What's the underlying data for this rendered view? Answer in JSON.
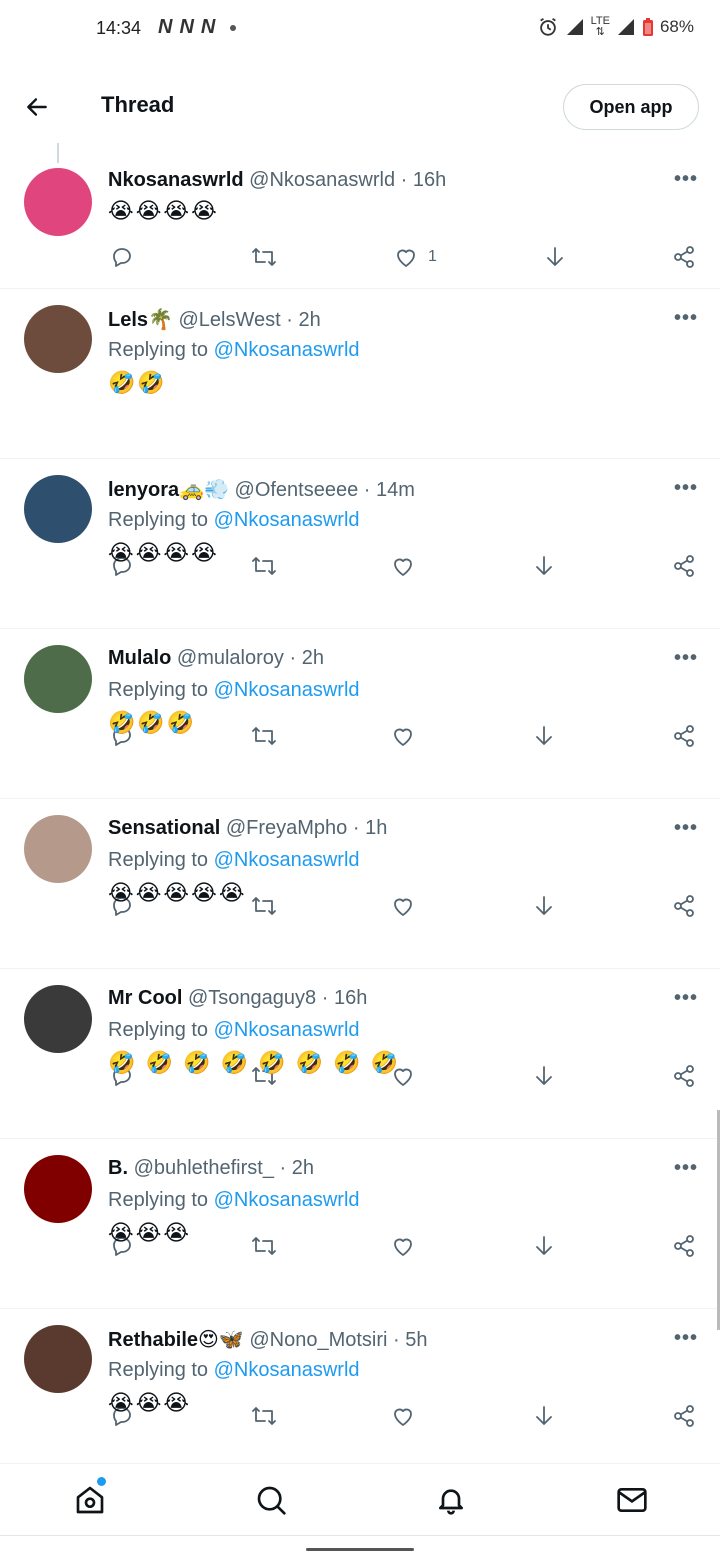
{
  "status_bar": {
    "time": "14:34",
    "notification_icons": [
      "N",
      "N",
      "N"
    ],
    "network_label": "LTE",
    "battery": "68%"
  },
  "header": {
    "title": "Thread",
    "open_app_label": "Open app"
  },
  "tweets": [
    {
      "name": "Nkosanaswrld",
      "handle": "@Nkosanaswrld",
      "time": "16h",
      "replying_to": "",
      "body": "😭😭😭😭",
      "likes": "1",
      "avatar_color": "#e0457e"
    },
    {
      "name": "Lels🌴",
      "handle": "@LelsWest",
      "time": "2h",
      "replying_label": "Replying to",
      "replying_to": "@Nkosanaswrld",
      "body": "🤣🤣",
      "likes": "",
      "avatar_color": "#6d4c3d"
    },
    {
      "name": "lenyora🚕💨",
      "handle": "@Ofentseeee",
      "time": "14m",
      "replying_label": "Replying to",
      "replying_to": "@Nkosanaswrld",
      "body": "😭😭😭😭",
      "likes": "",
      "avatar_color": "#2f4f6f"
    },
    {
      "name": "Mulalo",
      "handle": "@mulaloroy",
      "time": "2h",
      "replying_label": "Replying to",
      "replying_to": "@Nkosanaswrld",
      "body": "🤣🤣🤣",
      "likes": "",
      "avatar_color": "#4e6b4a"
    },
    {
      "name": "Sensational",
      "handle": "@FreyaMpho",
      "time": "1h",
      "replying_label": "Replying to",
      "replying_to": "@Nkosanaswrld",
      "body": "😭😭😭😭😭",
      "likes": "",
      "avatar_color": "#b59a8c"
    },
    {
      "name": "Mr Cool",
      "handle": "@Tsongaguy8",
      "time": "16h",
      "replying_label": "Replying to",
      "replying_to": "@Nkosanaswrld",
      "body": "🤣 🤣 🤣 🤣 🤣 🤣 🤣 🤣",
      "likes": "",
      "avatar_color": "#3a3a3a"
    },
    {
      "name": "B.",
      "handle": "@buhlethefirst_",
      "time": "2h",
      "replying_label": "Replying to",
      "replying_to": "@Nkosanaswrld",
      "body": "😭😭😭",
      "likes": "",
      "avatar_color": "#800000"
    },
    {
      "name": "Rethabile😍🦋",
      "handle": "@Nono_Motsiri",
      "time": "5h",
      "replying_label": "Replying to",
      "replying_to": "@Nkosanaswrld",
      "body": "😭😭😭",
      "likes": "",
      "avatar_color": "#5a3a2e"
    }
  ],
  "tab_bar": {
    "icons": [
      "home-icon",
      "search-icon",
      "notifications-icon",
      "messages-icon"
    ]
  },
  "colors": {
    "accent": "#1d9bf0",
    "secondary_text": "#536471",
    "primary_text": "#0f1419"
  }
}
